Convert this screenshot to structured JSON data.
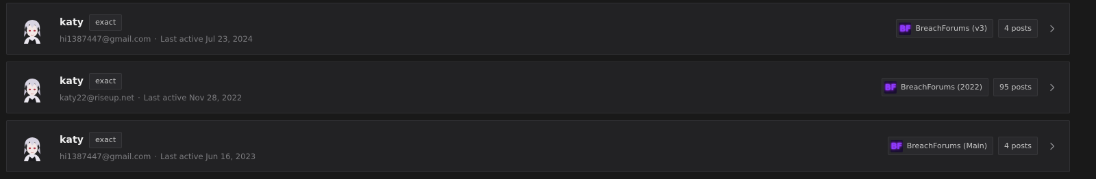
{
  "results": [
    {
      "username": "katy",
      "match_badge": "exact",
      "email": "hi1387447@gmail.com",
      "separator": "·",
      "last_active": "Last active Jul 23, 2024",
      "forum_icon_text": "BF",
      "forum": "BreachForums (v3)",
      "posts": "4 posts"
    },
    {
      "username": "katy",
      "match_badge": "exact",
      "email": "katy22@riseup.net",
      "separator": "·",
      "last_active": "Last active Nov 28, 2022",
      "forum_icon_text": "BF",
      "forum": "BreachForums (2022)",
      "posts": "95 posts"
    },
    {
      "username": "katy",
      "match_badge": "exact",
      "email": "hi1387447@gmail.com",
      "separator": "·",
      "last_active": "Last active Jun 16, 2023",
      "forum_icon_text": "BF",
      "forum": "BreachForums (Main)",
      "posts": "4 posts"
    }
  ],
  "icons": {
    "forum": "breachforums-logo-icon",
    "row_action": "chevron-right-icon",
    "avatar": "user-avatar"
  },
  "colors": {
    "background": "#191919",
    "row_background": "#222224",
    "row_border": "#303033",
    "chip_background": "#29292c",
    "forum_logo": "#8a3cff",
    "username": "#f1f1f1",
    "meta_text": "#7c7c7f"
  }
}
